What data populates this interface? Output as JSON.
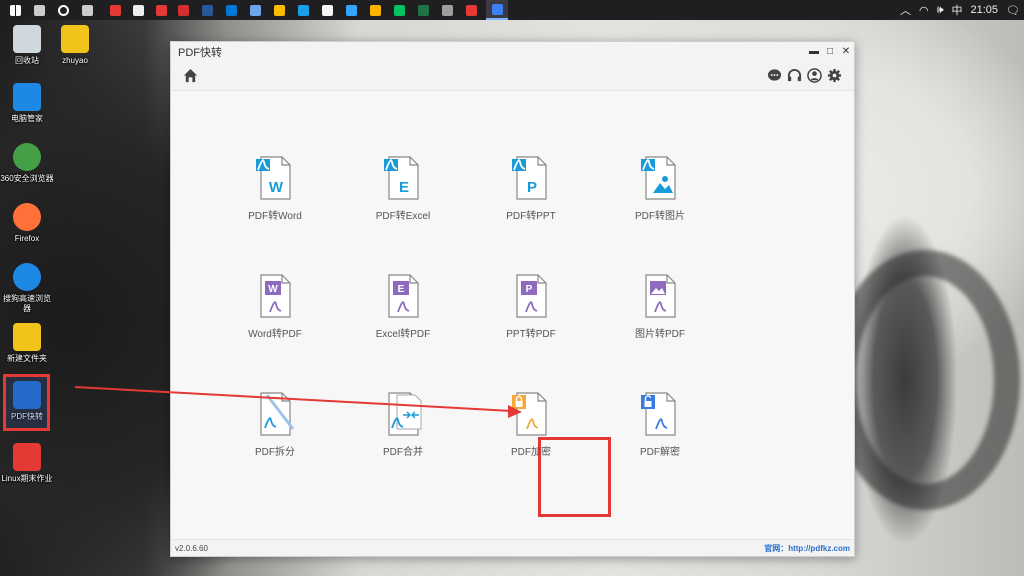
{
  "taskbar": {
    "time": "21:05",
    "ime": "中",
    "pinned": [
      "start-icon",
      "search-icon",
      "cortana-icon",
      "taskview-icon",
      "netease-music-icon",
      "notepad-icon",
      "app-icon",
      "netease-icon",
      "word-icon",
      "edge-icon",
      "app-icon",
      "chrome-icon",
      "qq-icon",
      "photos-icon",
      "photoshop-icon",
      "game-icon",
      "wechat-icon",
      "excel-icon",
      "media-icon",
      "pdf-icon",
      "pdfkz-icon"
    ]
  },
  "desktop": {
    "icons": [
      {
        "label": "回收站",
        "icon": "recycle-bin-icon",
        "color": "#cfd8dc"
      },
      {
        "label": "zhuyao",
        "icon": "zip-icon",
        "color": "#f0c419"
      },
      {
        "label": "电脑管家",
        "icon": "pc-manager-icon",
        "color": "#1e88e5"
      },
      {
        "label": "360安全浏览器",
        "icon": "360-browser-icon",
        "color": "#43a047"
      },
      {
        "label": "Firefox",
        "icon": "firefox-icon",
        "color": "#ff7139"
      },
      {
        "label": "搜狗高速浏览器",
        "icon": "sogou-browser-icon",
        "color": "#1e88e5"
      },
      {
        "label": "新建文件夹",
        "icon": "folder-zip-icon",
        "color": "#f0c419"
      },
      {
        "label": "PDF快转",
        "icon": "pdfkz-icon",
        "color": "#1e6fd9"
      },
      {
        "label": "Linux期末作业",
        "icon": "pdf-file-icon",
        "color": "#e53935"
      }
    ]
  },
  "window": {
    "title": "PDF快转",
    "version": "v2.0.6.60",
    "site": "官网：http://pdfkz.com",
    "colors": {
      "blue": "#1a9bd7",
      "purple": "#8e6bbf",
      "orange": "#f4a93b",
      "red": "#e53935"
    },
    "rows": [
      [
        {
          "label": "PDF转Word",
          "badge": "W",
          "badge_color": "#1a9bd7",
          "kind": "pdf-to",
          "icon": "pdf-to-word-icon"
        },
        {
          "label": "PDF转Excel",
          "badge": "E",
          "badge_color": "#1a9bd7",
          "kind": "pdf-to",
          "icon": "pdf-to-excel-icon"
        },
        {
          "label": "PDF转PPT",
          "badge": "P",
          "badge_color": "#1a9bd7",
          "kind": "pdf-to",
          "icon": "pdf-to-ppt-icon"
        },
        {
          "label": "PDF转图片",
          "badge": "image",
          "badge_color": "#1a9bd7",
          "kind": "pdf-to",
          "icon": "pdf-to-image-icon"
        }
      ],
      [
        {
          "label": "Word转PDF",
          "badge": "W",
          "badge_color": "#8e6bbf",
          "kind": "to-pdf",
          "icon": "word-to-pdf-icon"
        },
        {
          "label": "Excel转PDF",
          "badge": "E",
          "badge_color": "#8e6bbf",
          "kind": "to-pdf",
          "icon": "excel-to-pdf-icon"
        },
        {
          "label": "PPT转PDF",
          "badge": "P",
          "badge_color": "#8e6bbf",
          "kind": "to-pdf",
          "icon": "ppt-to-pdf-icon"
        },
        {
          "label": "图片转PDF",
          "badge": "image",
          "badge_color": "#8e6bbf",
          "kind": "to-pdf",
          "icon": "image-to-pdf-icon"
        }
      ],
      [
        {
          "label": "PDF拆分",
          "badge": "",
          "badge_color": "#1a9bd7",
          "kind": "split",
          "icon": "pdf-split-icon"
        },
        {
          "label": "PDF合并",
          "badge": "",
          "badge_color": "#1a9bd7",
          "kind": "merge",
          "icon": "pdf-merge-icon"
        },
        {
          "label": "PDF加密",
          "badge": "lock",
          "badge_color": "#f4a93b",
          "kind": "lock",
          "icon": "pdf-encrypt-icon"
        },
        {
          "label": "PDF解密",
          "badge": "unlock",
          "badge_color": "#3a7be0",
          "kind": "unlock",
          "icon": "pdf-decrypt-icon"
        }
      ]
    ]
  }
}
